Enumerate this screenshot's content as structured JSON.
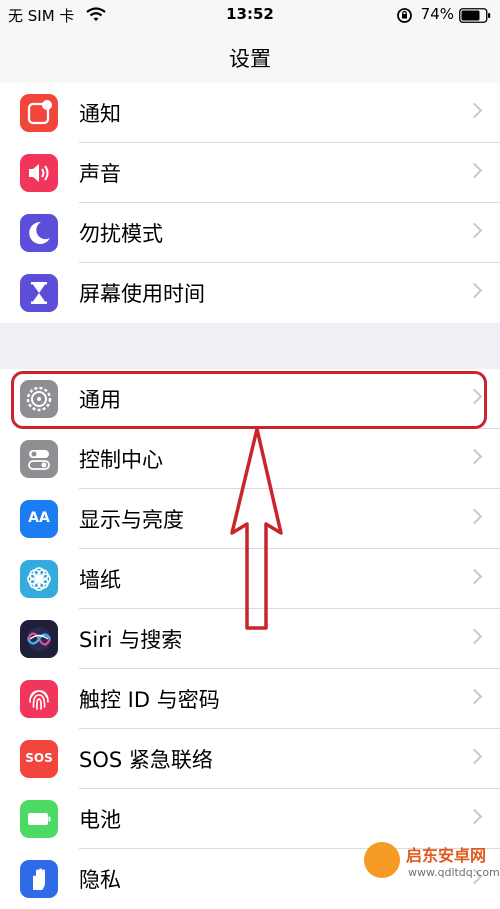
{
  "status": {
    "carrier": "无 SIM 卡",
    "time": "13:52",
    "battery": "74%"
  },
  "nav": {
    "title": "设置"
  },
  "colors": {
    "highlight": "#c8252c",
    "chevron": "#c7c7cc",
    "separator": "#d9d9dd"
  },
  "group1": [
    {
      "label": "通知",
      "icon": "notifications-icon",
      "color": "#f2453b"
    },
    {
      "label": "声音",
      "icon": "sounds-icon",
      "color": "#f2355b"
    },
    {
      "label": "勿扰模式",
      "icon": "do-not-disturb-icon",
      "color": "#5c4ed8"
    },
    {
      "label": "屏幕使用时间",
      "icon": "screen-time-icon",
      "color": "#5c4ed8"
    }
  ],
  "group2": [
    {
      "label": "通用",
      "icon": "general-icon",
      "color": "#8e8e93"
    },
    {
      "label": "控制中心",
      "icon": "control-center-icon",
      "color": "#8e8e93"
    },
    {
      "label": "显示与亮度",
      "icon": "display-brightness-icon",
      "color": "#1c7cf2"
    },
    {
      "label": "墙纸",
      "icon": "wallpaper-icon",
      "color": "#35aadc"
    },
    {
      "label": "Siri 与搜索",
      "icon": "siri-icon",
      "color": "#1f1f3a"
    },
    {
      "label": "触控 ID 与密码",
      "icon": "touch-id-icon",
      "color": "#f2355b"
    },
    {
      "label": "SOS 紧急联络",
      "icon": "sos-icon",
      "color": "#f2453b"
    },
    {
      "label": "电池",
      "icon": "battery-settings-icon",
      "color": "#4cd964"
    },
    {
      "label": "隐私",
      "icon": "privacy-icon",
      "color": "#2f6be6"
    }
  ],
  "icon_text": {
    "display": "AA",
    "sos": "SOS"
  },
  "watermark": {
    "brand": "启东安卓网",
    "url": "www.qdltdq.com"
  }
}
